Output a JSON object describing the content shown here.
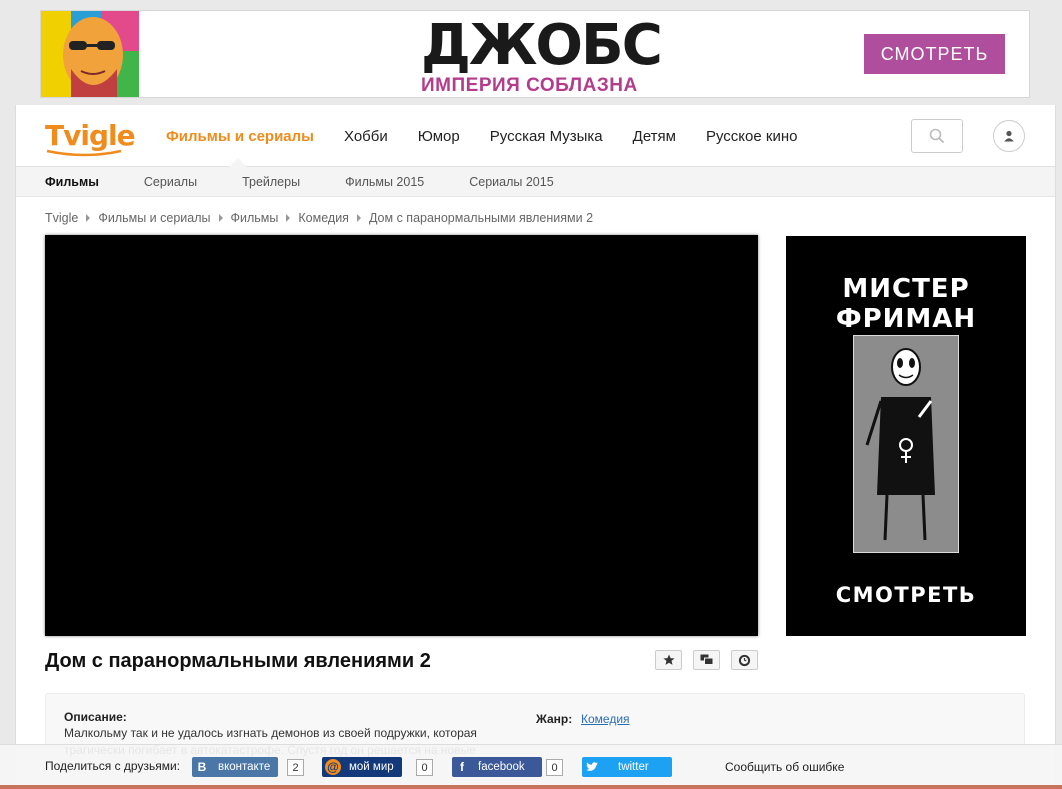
{
  "top_ad": {
    "title": "ДЖОБС",
    "subtitle": "ИМПЕРИЯ СОБЛАЗНА",
    "button": "СМОТРЕТЬ",
    "accent": "#b04e9e"
  },
  "header": {
    "logo": "Tvigle",
    "nav": [
      "Фильмы и сериалы",
      "Хобби",
      "Юмор",
      "Русская Музыка",
      "Детям",
      "Русское кино"
    ],
    "active_nav": "Фильмы и сериалы",
    "brand_color": "#f08c1e",
    "search_icon": "search-icon",
    "user_icon": "user-icon"
  },
  "subnav": {
    "items": [
      "Фильмы",
      "Сериалы",
      "Трейлеры",
      "Фильмы 2015",
      "Сериалы 2015"
    ],
    "active": "Фильмы"
  },
  "breadcrumb": [
    "Tvigle",
    "Фильмы и сериалы",
    "Фильмы",
    "Комедия",
    "Дом с паранормальными явлениями 2"
  ],
  "side_ad": {
    "title": "МИСТЕР ФРИМАН",
    "button": "СМОТРЕТЬ"
  },
  "movie": {
    "title": "Дом с паранормальными явлениями 2",
    "actions": [
      "star-icon",
      "comments-icon",
      "clock-icon"
    ],
    "description_label": "Описание:",
    "description": "Малкольму так и не удалось изгнать демонов из своей подружки, которая трагически погибает в автокатастрофе. Спустя год он решается на новые",
    "genre_label": "Жанр:",
    "genre": "Комедия"
  },
  "share": {
    "label": "Поделиться с друзьями:",
    "buttons": [
      {
        "label": "вконтакте",
        "icon": "B",
        "color": "#4a76a8",
        "count": "2"
      },
      {
        "label": "мой мир",
        "icon": "@",
        "color": "#14397a",
        "count": "0"
      },
      {
        "label": "facebook",
        "icon": "f",
        "color": "#3b5998",
        "count": "0"
      },
      {
        "label": "twitter",
        "icon": "t",
        "color": "#1da1f2"
      }
    ],
    "report": "Сообщить об ошибке"
  }
}
